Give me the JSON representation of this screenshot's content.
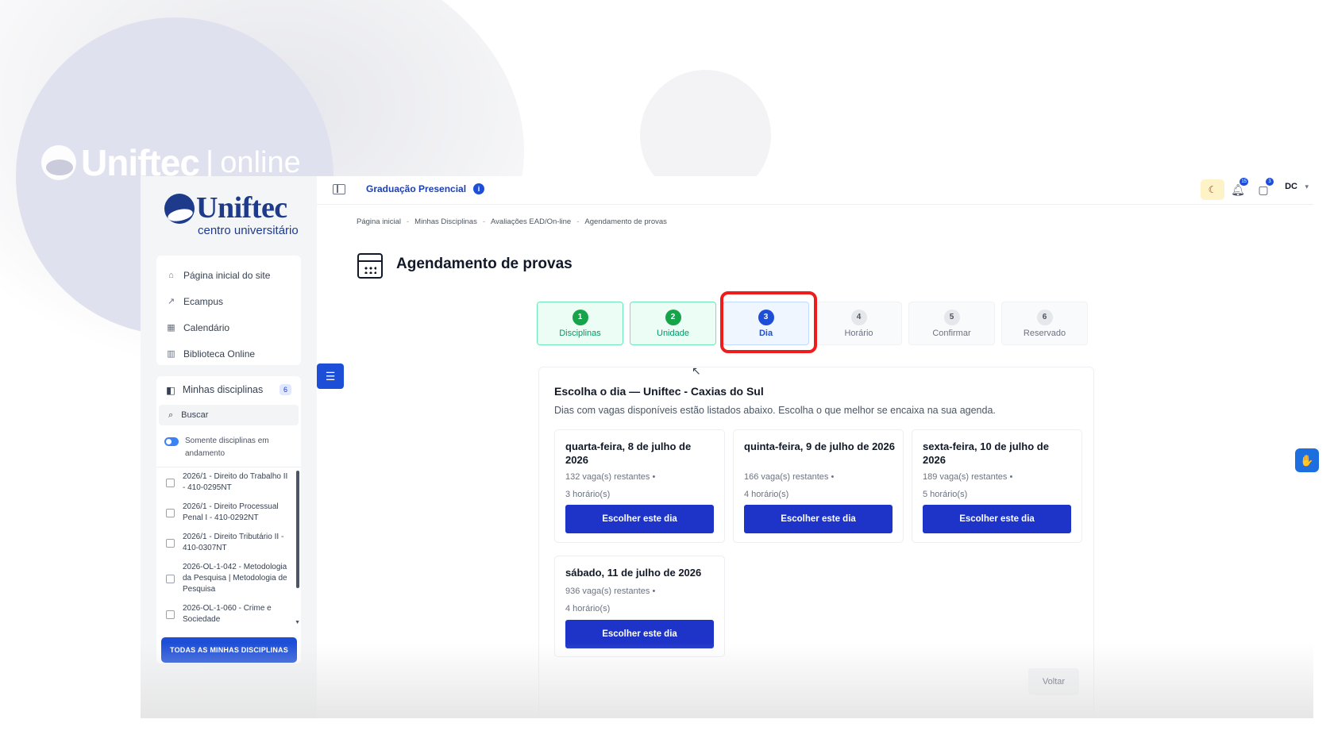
{
  "background": {
    "brand_word": "Uniftec",
    "brand_sep": "|",
    "brand_suffix": "online"
  },
  "logo": {
    "name": "Uniftec",
    "subtitle": "centro universitário"
  },
  "sidebar": {
    "links": [
      {
        "label": "Página inicial do site",
        "icon": "home-icon"
      },
      {
        "label": "Ecampus",
        "icon": "external-link-icon"
      },
      {
        "label": "Calendário",
        "icon": "calendar-icon"
      },
      {
        "label": "Biblioteca Online",
        "icon": "library-icon"
      }
    ],
    "disciplines": {
      "label": "Minhas disciplinas",
      "count": "6",
      "search_label": "Buscar",
      "toggle_label": "Somente disciplinas em andamento",
      "toggle_on": true,
      "courses": [
        "2026/1 - Direito do Trabalho II - 410-0295NT",
        "2026/1 - Direito Processual Penal I - 410-0292NT",
        "2026/1 - Direito Tributário II - 410-0307NT",
        "2026-OL-1-042 - Metodologia da Pesquisa | Metodologia de Pesquisa",
        "2026-OL-1-060 - Crime e Sociedade"
      ]
    },
    "all_button": "TODAS AS MINHAS DISCIPLINAS"
  },
  "topbar": {
    "course_mode": "Graduação Presencial",
    "info_glyph": "i",
    "notifications_count": "15",
    "messages_count": "3",
    "user_initials": "DC"
  },
  "breadcrumb": [
    "Página inicial",
    "Minhas Disciplinas",
    "Avaliações EAD/On-line",
    "Agendamento de provas"
  ],
  "page": {
    "title": "Agendamento de provas"
  },
  "stepper": {
    "current": 3,
    "steps": [
      {
        "num": "1",
        "label": "Disciplinas",
        "state": "done"
      },
      {
        "num": "2",
        "label": "Unidade",
        "state": "done"
      },
      {
        "num": "3",
        "label": "Dia",
        "state": "active"
      },
      {
        "num": "4",
        "label": "Horário",
        "state": "todo"
      },
      {
        "num": "5",
        "label": "Confirmar",
        "state": "todo"
      },
      {
        "num": "6",
        "label": "Reservado",
        "state": "todo"
      }
    ]
  },
  "panel": {
    "title": "Escolha o dia — Uniftec - Caxias do Sul",
    "description": "Dias com vagas disponíveis estão listados abaixo. Escolha o que melhor se encaixa na sua agenda.",
    "days": [
      {
        "date": "quarta-feira, 8 de julho de 2026",
        "vagas": "132 vaga(s) restantes  •",
        "horarios": "3 horário(s)",
        "button": "Escolher este dia"
      },
      {
        "date": "quinta-feira, 9 de julho de 2026",
        "vagas": "166 vaga(s) restantes  •",
        "horarios": "4 horário(s)",
        "button": "Escolher este dia"
      },
      {
        "date": "sexta-feira, 10 de julho de 2026",
        "vagas": "189 vaga(s) restantes  •",
        "horarios": "5 horário(s)",
        "button": "Escolher este dia"
      },
      {
        "date": "sábado, 11 de julho de 2026",
        "vagas": "936 vaga(s) restantes  •",
        "horarios": "4 horário(s)",
        "button": "Escolher este dia"
      }
    ],
    "back_button": "Voltar"
  },
  "colors": {
    "primary": "#1e34c8",
    "brand": "#1e3a8a",
    "success": "#16a34a",
    "highlight": "#ef1c1c"
  }
}
